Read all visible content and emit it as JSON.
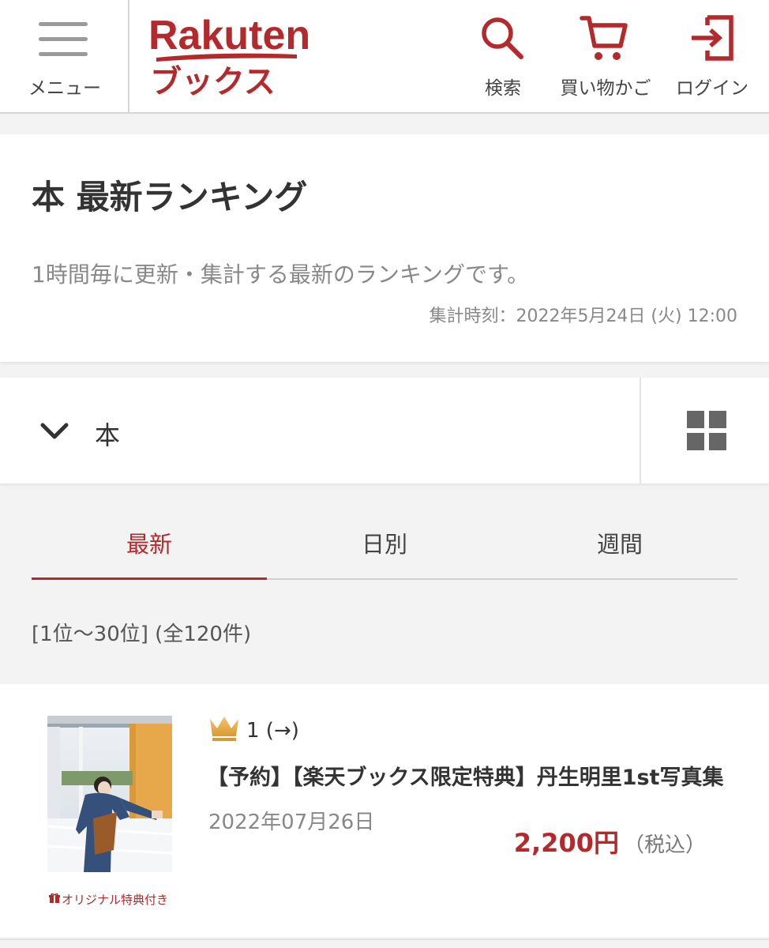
{
  "header": {
    "menu_label": "メニュー",
    "logo_top": "Rakuten",
    "logo_bottom": "ブックス",
    "search_label": "検索",
    "cart_label": "買い物かご",
    "login_label": "ログイン"
  },
  "title_section": {
    "title": "本 最新ランキング",
    "description": "1時間毎に更新・集計する最新のランキングです。",
    "aggregated_at": "集計時刻：2022年5月24日 (火) 12:00"
  },
  "category": {
    "selected": "本"
  },
  "tabs": [
    {
      "label": "最新",
      "active": true
    },
    {
      "label": "日別",
      "active": false
    },
    {
      "label": "週間",
      "active": false
    }
  ],
  "list_info": "[1位〜30位] (全120件)",
  "items": [
    {
      "rank": "1 (→)",
      "title": "【予約】【楽天ブックス限定特典】丹生明里1st写真集",
      "release_date": "2022年07月26日",
      "price": "2,200円",
      "tax_note": "（税込）",
      "bonus_label": "オリジナル特典付き"
    }
  ],
  "colors": {
    "brand_red": "#b4292b",
    "text_dark": "#333333",
    "text_gray": "#888888",
    "background": "#f3f3f3"
  },
  "icons": [
    "hamburger-icon",
    "search-icon",
    "cart-icon",
    "login-icon",
    "chevron-down-icon",
    "grid-view-icon",
    "crown-icon",
    "gift-icon"
  ]
}
